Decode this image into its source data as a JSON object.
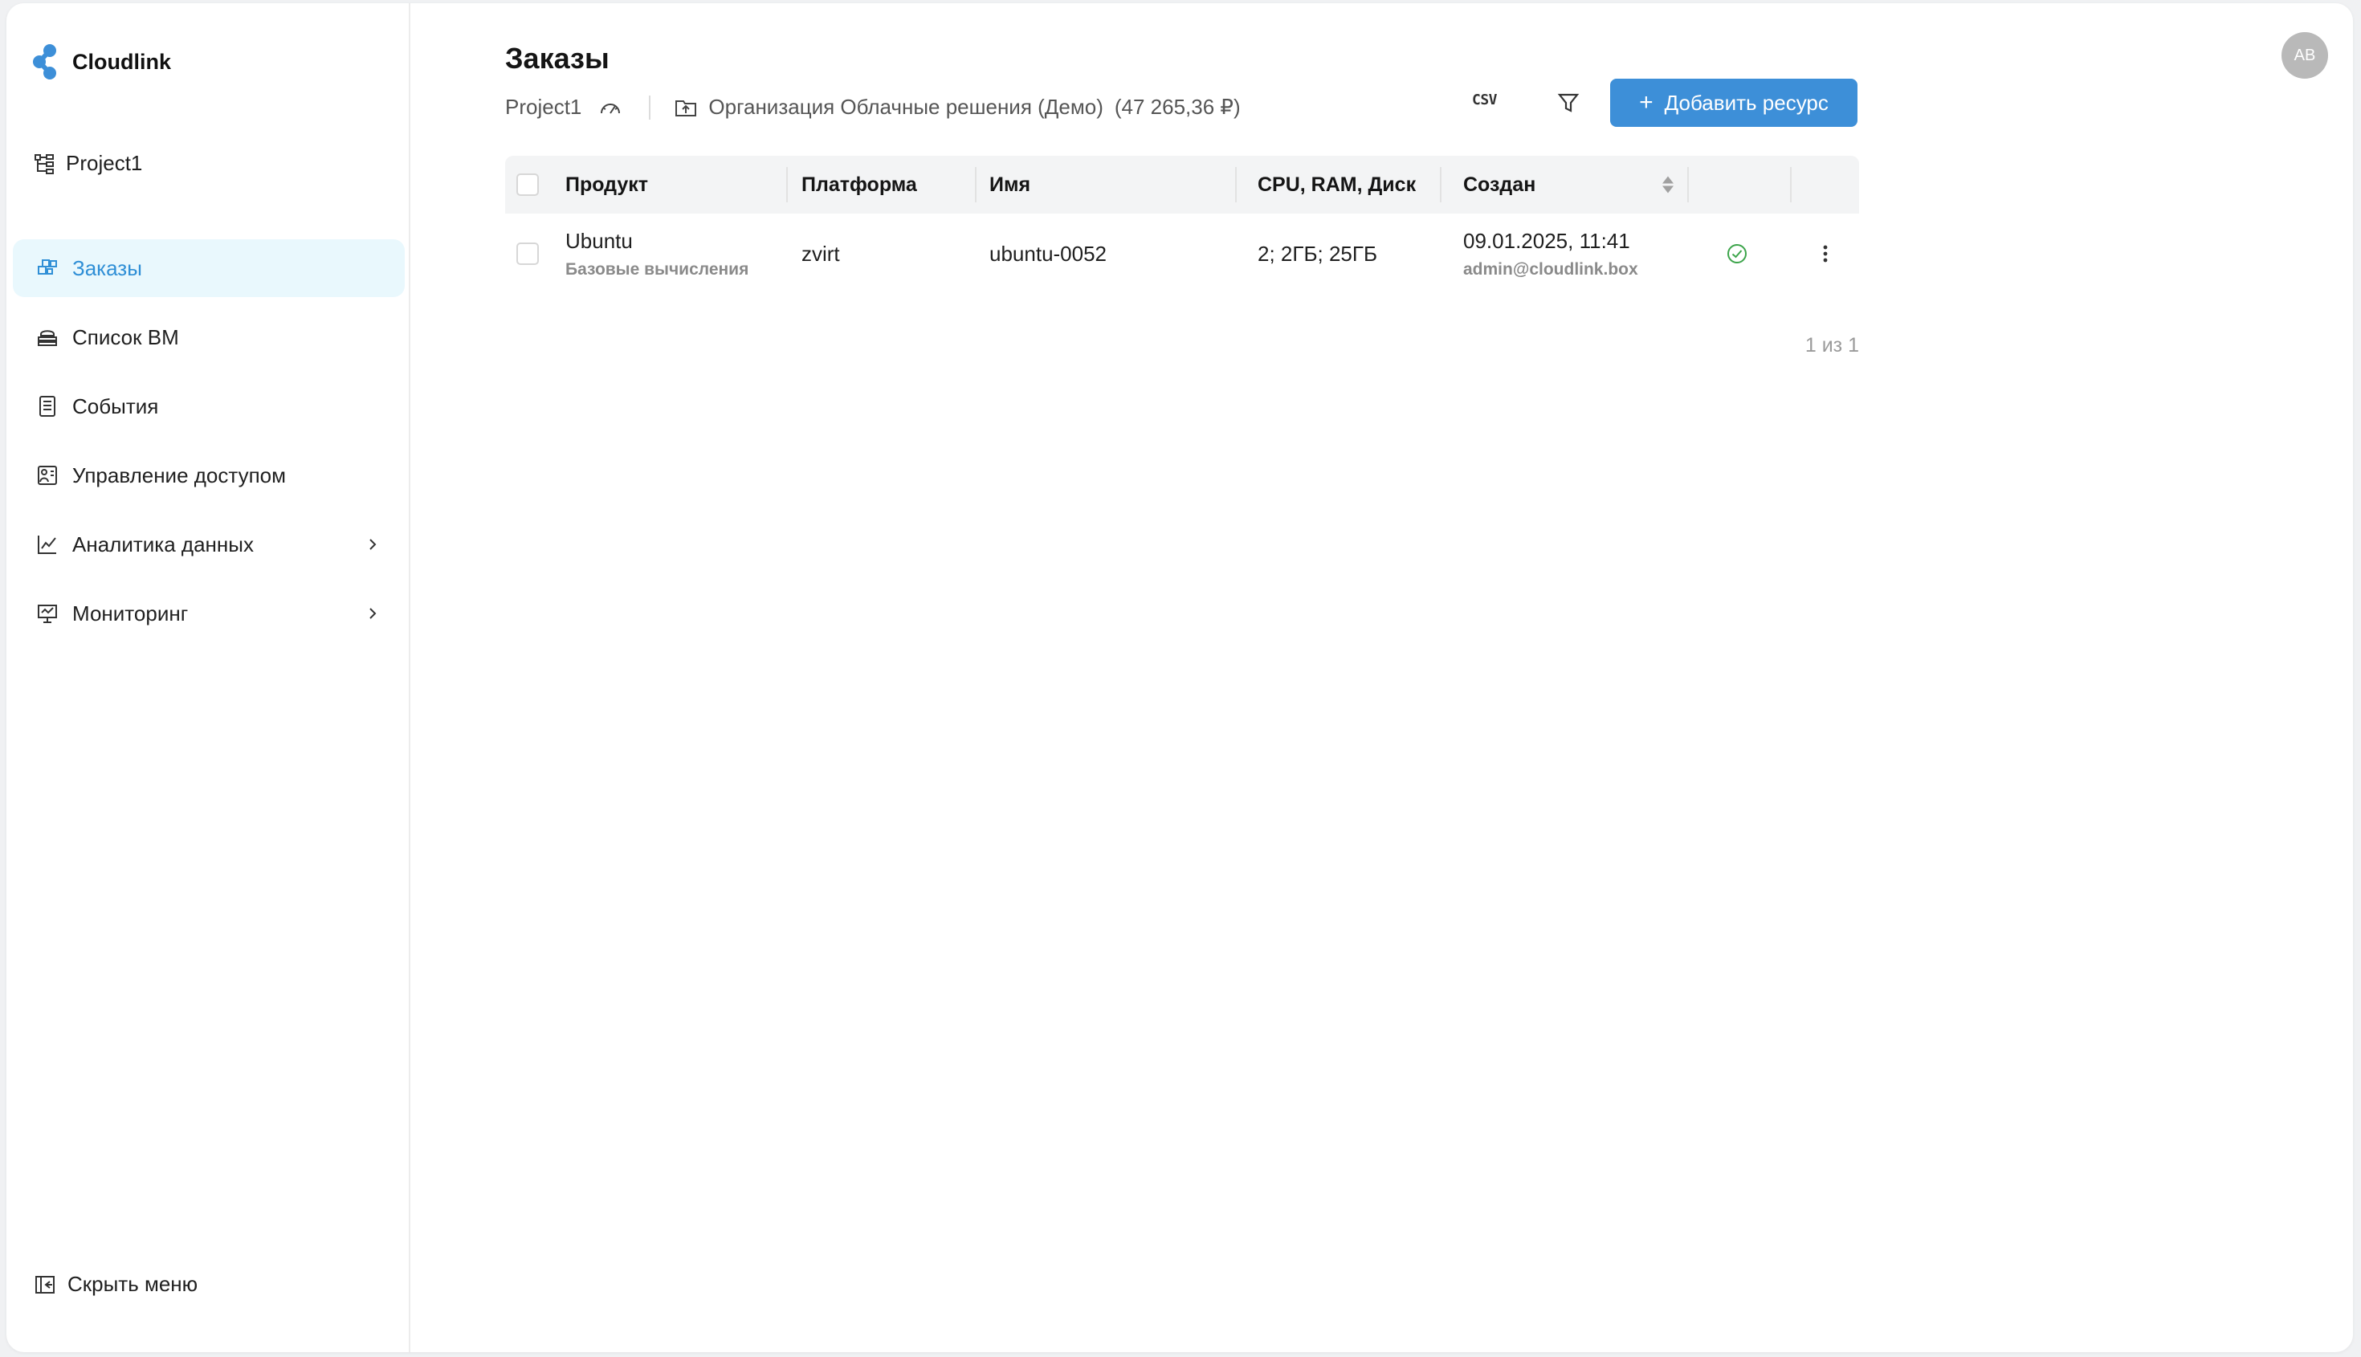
{
  "brand": {
    "name": "Cloudlink",
    "accent": "#3d8fd8",
    "active_bg": "#e9f8fd"
  },
  "sidebar": {
    "project": "Project1",
    "items": [
      {
        "label": "Заказы",
        "icon": "orders-icon",
        "active": true
      },
      {
        "label": "Список ВМ",
        "icon": "vm-list-icon",
        "active": false
      },
      {
        "label": "События",
        "icon": "events-icon",
        "active": false
      },
      {
        "label": "Управление доступом",
        "icon": "access-icon",
        "active": false
      },
      {
        "label": "Аналитика данных",
        "icon": "analytics-icon",
        "active": false,
        "expandable": true
      },
      {
        "label": "Мониторинг",
        "icon": "monitoring-icon",
        "active": false,
        "expandable": true
      }
    ],
    "hide_menu": "Скрыть меню"
  },
  "header": {
    "title": "Заказы",
    "project": "Project1",
    "organization": "Организация Облачные решения (Демо)",
    "balance": "(47 265,36 ₽)",
    "csv_label": "CSV",
    "add_button": "Добавить ресурс",
    "avatar_initials": "AB"
  },
  "table": {
    "columns": [
      "Продукт",
      "Платформа",
      "Имя",
      "CPU, RAM, Диск",
      "Создан"
    ],
    "rows": [
      {
        "product": "Ubuntu",
        "product_sub": "Базовые вычисления",
        "platform": "zvirt",
        "name": "ubuntu-0052",
        "resources": "2; 2ГБ; 25ГБ",
        "created": "09.01.2025, 11:41",
        "created_by": "admin@cloudlink.box",
        "status": "ok"
      }
    ],
    "pager": "1 из 1"
  }
}
